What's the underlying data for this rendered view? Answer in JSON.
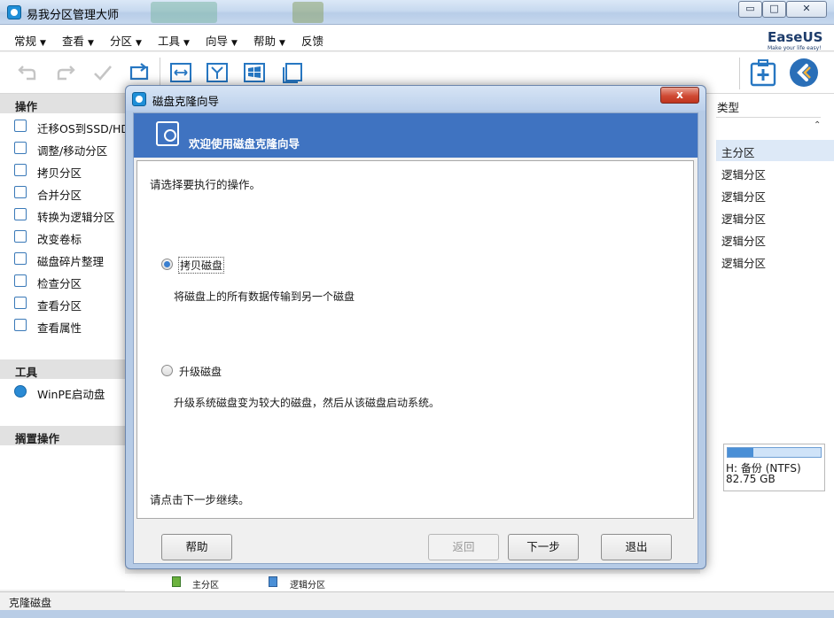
{
  "window": {
    "title": "易我分区管理大师",
    "min_label": "▭",
    "max_label": "□",
    "close_label": "✕"
  },
  "menu": {
    "items": [
      {
        "label": "常规"
      },
      {
        "label": "查看"
      },
      {
        "label": "分区"
      },
      {
        "label": "工具"
      },
      {
        "label": "向导"
      },
      {
        "label": "帮助"
      },
      {
        "label": "反馈"
      }
    ]
  },
  "brand": {
    "name": "EaseUS",
    "tagline": "Make your life easy!"
  },
  "toolbar": {
    "icons": [
      "undo-icon",
      "redo-icon",
      "apply-icon",
      "refresh-icon",
      "resize-icon",
      "merge-icon",
      "windows-icon",
      "copy-icon"
    ],
    "right_icons": [
      "clone-disk-icon",
      "back-arrow-icon"
    ]
  },
  "left_panel": {
    "operations_header": "操作",
    "operations": [
      {
        "label": "迁移OS到SSD/HDD",
        "icon": "migrate-os-icon"
      },
      {
        "label": "调整/移动分区",
        "icon": "resize-move-icon"
      },
      {
        "label": "拷贝分区",
        "icon": "copy-partition-icon"
      },
      {
        "label": "合并分区",
        "icon": "merge-partition-icon"
      },
      {
        "label": "转换为逻辑分区",
        "icon": "convert-logical-icon"
      },
      {
        "label": "改变卷标",
        "icon": "change-label-icon"
      },
      {
        "label": "磁盘碎片整理",
        "icon": "defrag-icon"
      },
      {
        "label": "检查分区",
        "icon": "check-partition-icon"
      },
      {
        "label": "查看分区",
        "icon": "explore-partition-icon"
      },
      {
        "label": "查看属性",
        "icon": "properties-icon"
      }
    ],
    "tools_header": "工具",
    "tools": [
      {
        "label": "WinPE启动盘",
        "icon": "winpe-icon"
      }
    ],
    "pending_header": "搁置操作"
  },
  "partition_list": {
    "type_header": "类型",
    "types": [
      "主分区",
      "逻辑分区",
      "逻辑分区",
      "逻辑分区",
      "逻辑分区",
      "逻辑分区"
    ]
  },
  "disk_map": {
    "name": "H: 备份 (NTFS)",
    "size": "82.75 GB",
    "used_fraction": 0.28
  },
  "legend": {
    "primary": "主分区",
    "logical": "逻辑分区",
    "primary_color": "#6cb33e",
    "logical_color": "#4a8fd6"
  },
  "status": {
    "text": "克隆磁盘"
  },
  "dialog": {
    "title": "磁盘克隆向导",
    "close_label": "x",
    "banner_title": "欢迎使用磁盘克隆向导",
    "prompt": "请选择要执行的操作。",
    "options": [
      {
        "label": "拷贝磁盘",
        "description": "将磁盘上的所有数据传输到另一个磁盘",
        "selected": true
      },
      {
        "label": "升级磁盘",
        "description": "升级系统磁盘变为较大的磁盘，然后从该磁盘启动系统。",
        "selected": false
      }
    ],
    "hint": "请点击下一步继续。",
    "buttons": {
      "help": "帮助",
      "back": "返回",
      "next": "下一步",
      "exit": "退出"
    }
  }
}
